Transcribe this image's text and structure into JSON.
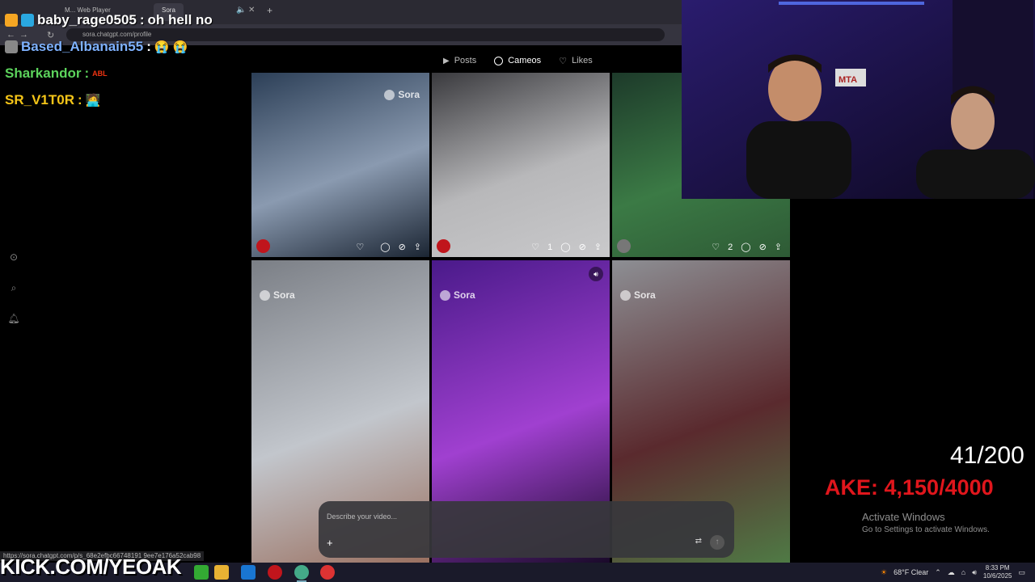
{
  "browser": {
    "tabs": [
      {
        "label": "M... Web Player"
      },
      {
        "label": "Sora"
      }
    ],
    "address": "sora.chatgpt.com/profile",
    "status_url": "https://sora.chatgpt.com/p/s_68e2efbc66748191 9ee7e176a52cab98"
  },
  "chat": {
    "messages": [
      {
        "user": "baby_rage0505",
        "text": "oh hell no",
        "user_color": "#ffffff",
        "emote": ""
      },
      {
        "user": "Based_Albanain55",
        "text": "",
        "user_color": "#7fb2ff",
        "emote": "😭 😭"
      },
      {
        "user": "Sharkandor",
        "text": "",
        "user_color": "#5cd35c",
        "emote": "neon-sign"
      },
      {
        "user": "SR_V1T0R",
        "text": "",
        "user_color": "#f5c518",
        "emote": "🧑‍💻"
      }
    ],
    "neon_emote_text": "ABL"
  },
  "sora": {
    "tabs": [
      {
        "label": "Posts",
        "icon": "play-icon",
        "active": false
      },
      {
        "label": "Cameos",
        "icon": "cameo-icon",
        "active": true
      },
      {
        "label": "Likes",
        "icon": "heart-icon",
        "active": false
      }
    ],
    "watermark": "Sora",
    "cards": [
      {
        "likes": "",
        "colors": [
          "#2c3f57",
          "#8a9ab0",
          "#1b2533"
        ]
      },
      {
        "likes": "1",
        "colors": [
          "#3a3a3e",
          "#b8b8ba",
          "#c9c9cb"
        ]
      },
      {
        "likes": "2",
        "colors": [
          "#1d3a2a",
          "#3b7a45",
          "#2e5a35"
        ]
      },
      {
        "likes": "",
        "colors": [
          "#7b7f86",
          "#c2c6cc",
          "#9a7060"
        ]
      },
      {
        "likes": "",
        "colors": [
          "#4a1a8a",
          "#a040d0",
          "#1a0a2a"
        ]
      },
      {
        "likes": "",
        "colors": [
          "#8d8f94",
          "#5a2a2e",
          "#4f7a45"
        ]
      }
    ],
    "prompt_placeholder": "Describe your video...",
    "sidebar_icons": [
      "play-icon",
      "search-icon",
      "bell-icon"
    ]
  },
  "overlay": {
    "goal_count": "41/200",
    "goal_text": "AKE: 4,150/4000",
    "goal_color": "#e0161c",
    "kick_text": "KICK.COM/YEOAK",
    "activate_title": "Activate Windows",
    "activate_sub": "Go to Settings to activate Windows."
  },
  "taskbar": {
    "weather": "68°F  Clear",
    "time": "8:33 PM",
    "date": "10/6/2025"
  },
  "colors": {
    "background": "#000000",
    "taskbar": "#1a1a2a",
    "chrome": "#2b2a33"
  }
}
